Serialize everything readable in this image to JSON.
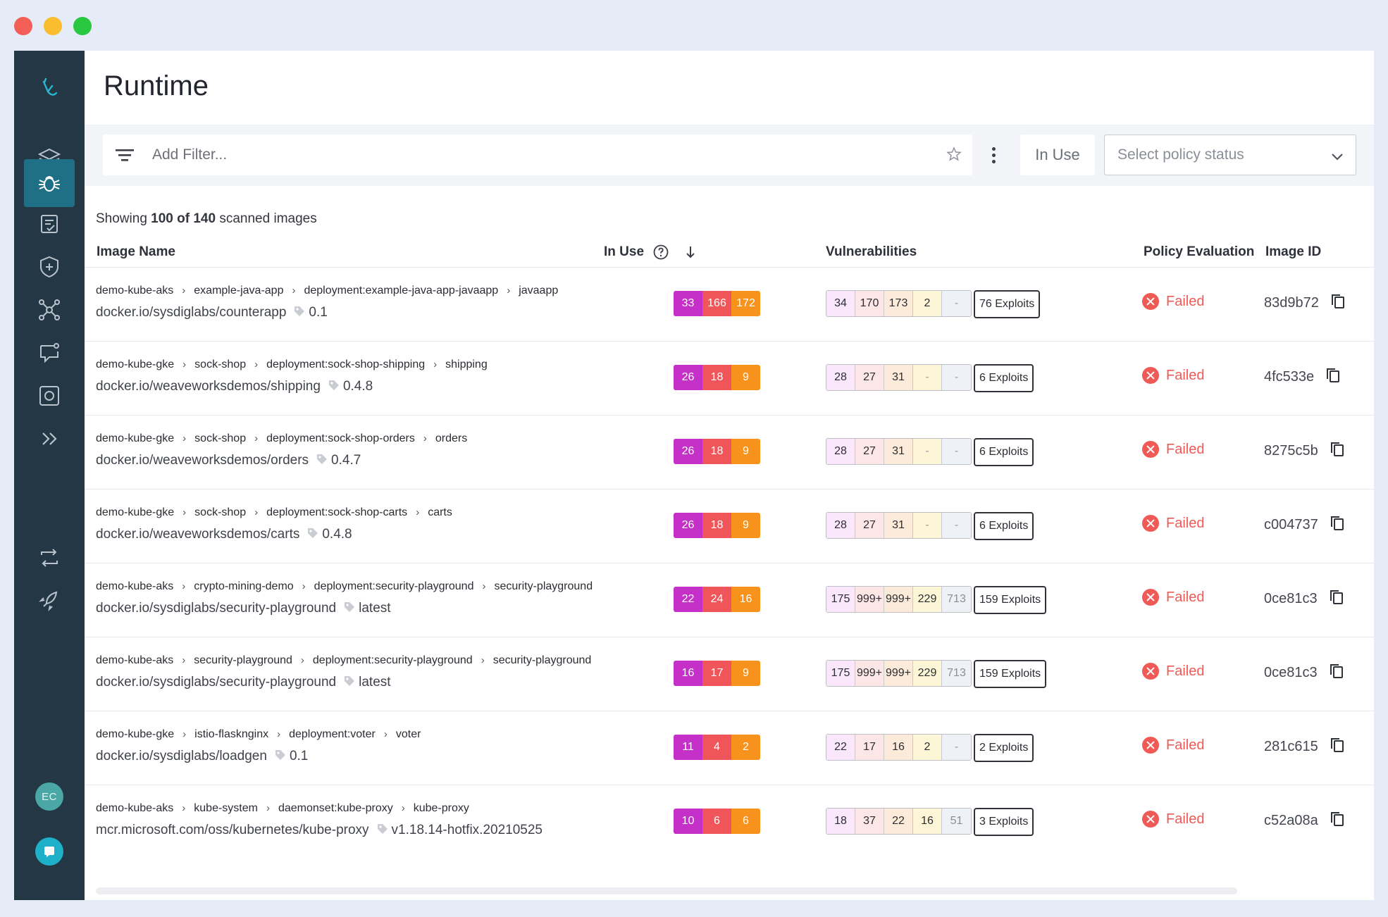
{
  "window": {
    "traffic_lights": [
      "close",
      "minimize",
      "maximize"
    ]
  },
  "sidebar": {
    "items": [
      {
        "icon": "logo-icon"
      },
      {
        "icon": "layers-icon"
      },
      {
        "icon": "bug-icon",
        "active": true
      },
      {
        "icon": "checklist-icon"
      },
      {
        "icon": "shield-plus-icon"
      },
      {
        "icon": "network-icon"
      },
      {
        "icon": "chat-alert-icon"
      },
      {
        "icon": "capture-icon"
      },
      {
        "icon": "expand-icon"
      },
      {
        "icon": "integrations-icon"
      },
      {
        "icon": "rocket-icon"
      }
    ],
    "avatar_initials": "EC",
    "chat_icon": "chat-icon"
  },
  "header": {
    "title": "Runtime"
  },
  "filterbar": {
    "placeholder": "Add Filter...",
    "in_use_label": "In Use",
    "policy_placeholder": "Select policy status"
  },
  "summary": {
    "prefix": "Showing",
    "count": "100 of 140",
    "suffix": "scanned images"
  },
  "table": {
    "columns": {
      "image_name": "Image Name",
      "in_use": "In Use",
      "vulnerabilities": "Vulnerabilities",
      "policy": "Policy Evaluation",
      "image_id": "Image ID"
    },
    "rows": [
      {
        "crumbs": [
          "demo-kube-aks",
          "example-java-app",
          "deployment:example-java-app-javaapp",
          "javaapp"
        ],
        "repo": "docker.io/sysdiglabs/counterapp",
        "tag": "0.1",
        "in_use": [
          "33",
          "166",
          "172"
        ],
        "vulns": [
          "34",
          "170",
          "173",
          "2",
          "-"
        ],
        "exploits": "76 Exploits",
        "policy": "Failed",
        "image_id": "83d9b72"
      },
      {
        "crumbs": [
          "demo-kube-gke",
          "sock-shop",
          "deployment:sock-shop-shipping",
          "shipping"
        ],
        "repo": "docker.io/weaveworksdemos/shipping",
        "tag": "0.4.8",
        "in_use": [
          "26",
          "18",
          "9"
        ],
        "vulns": [
          "28",
          "27",
          "31",
          "-",
          "-"
        ],
        "exploits": "6 Exploits",
        "policy": "Failed",
        "image_id": "4fc533e"
      },
      {
        "crumbs": [
          "demo-kube-gke",
          "sock-shop",
          "deployment:sock-shop-orders",
          "orders"
        ],
        "repo": "docker.io/weaveworksdemos/orders",
        "tag": "0.4.7",
        "in_use": [
          "26",
          "18",
          "9"
        ],
        "vulns": [
          "28",
          "27",
          "31",
          "-",
          "-"
        ],
        "exploits": "6 Exploits",
        "policy": "Failed",
        "image_id": "8275c5b"
      },
      {
        "crumbs": [
          "demo-kube-gke",
          "sock-shop",
          "deployment:sock-shop-carts",
          "carts"
        ],
        "repo": "docker.io/weaveworksdemos/carts",
        "tag": "0.4.8",
        "in_use": [
          "26",
          "18",
          "9"
        ],
        "vulns": [
          "28",
          "27",
          "31",
          "-",
          "-"
        ],
        "exploits": "6 Exploits",
        "policy": "Failed",
        "image_id": "c004737"
      },
      {
        "crumbs": [
          "demo-kube-aks",
          "crypto-mining-demo",
          "deployment:security-playground",
          "security-playground"
        ],
        "repo": "docker.io/sysdiglabs/security-playground",
        "tag": "latest",
        "in_use": [
          "22",
          "24",
          "16"
        ],
        "vulns": [
          "175",
          "999+",
          "999+",
          "229",
          "713"
        ],
        "exploits": "159 Exploits",
        "policy": "Failed",
        "image_id": "0ce81c3"
      },
      {
        "crumbs": [
          "demo-kube-aks",
          "security-playground",
          "deployment:security-playground",
          "security-playground"
        ],
        "repo": "docker.io/sysdiglabs/security-playground",
        "tag": "latest",
        "in_use": [
          "16",
          "17",
          "9"
        ],
        "vulns": [
          "175",
          "999+",
          "999+",
          "229",
          "713"
        ],
        "exploits": "159 Exploits",
        "policy": "Failed",
        "image_id": "0ce81c3"
      },
      {
        "crumbs": [
          "demo-kube-gke",
          "istio-flasknginx",
          "deployment:voter",
          "voter"
        ],
        "repo": "docker.io/sysdiglabs/loadgen",
        "tag": "0.1",
        "in_use": [
          "11",
          "4",
          "2"
        ],
        "vulns": [
          "22",
          "17",
          "16",
          "2",
          "-"
        ],
        "exploits": "2 Exploits",
        "policy": "Failed",
        "image_id": "281c615"
      },
      {
        "crumbs": [
          "demo-kube-aks",
          "kube-system",
          "daemonset:kube-proxy",
          "kube-proxy"
        ],
        "repo": "mcr.microsoft.com/oss/kubernetes/kube-proxy",
        "tag": "v1.18.14-hotfix.20210525",
        "in_use": [
          "10",
          "6",
          "6"
        ],
        "vulns": [
          "18",
          "37",
          "22",
          "16",
          "51"
        ],
        "exploits": "3 Exploits",
        "policy": "Failed",
        "image_id": "c52a08a"
      }
    ]
  },
  "colors": {
    "sidebar": "#243745",
    "active": "#1f6f87",
    "critical": "#c530c9",
    "high": "#f0555a",
    "medium": "#f7931c",
    "failed": "#ef5a57"
  }
}
